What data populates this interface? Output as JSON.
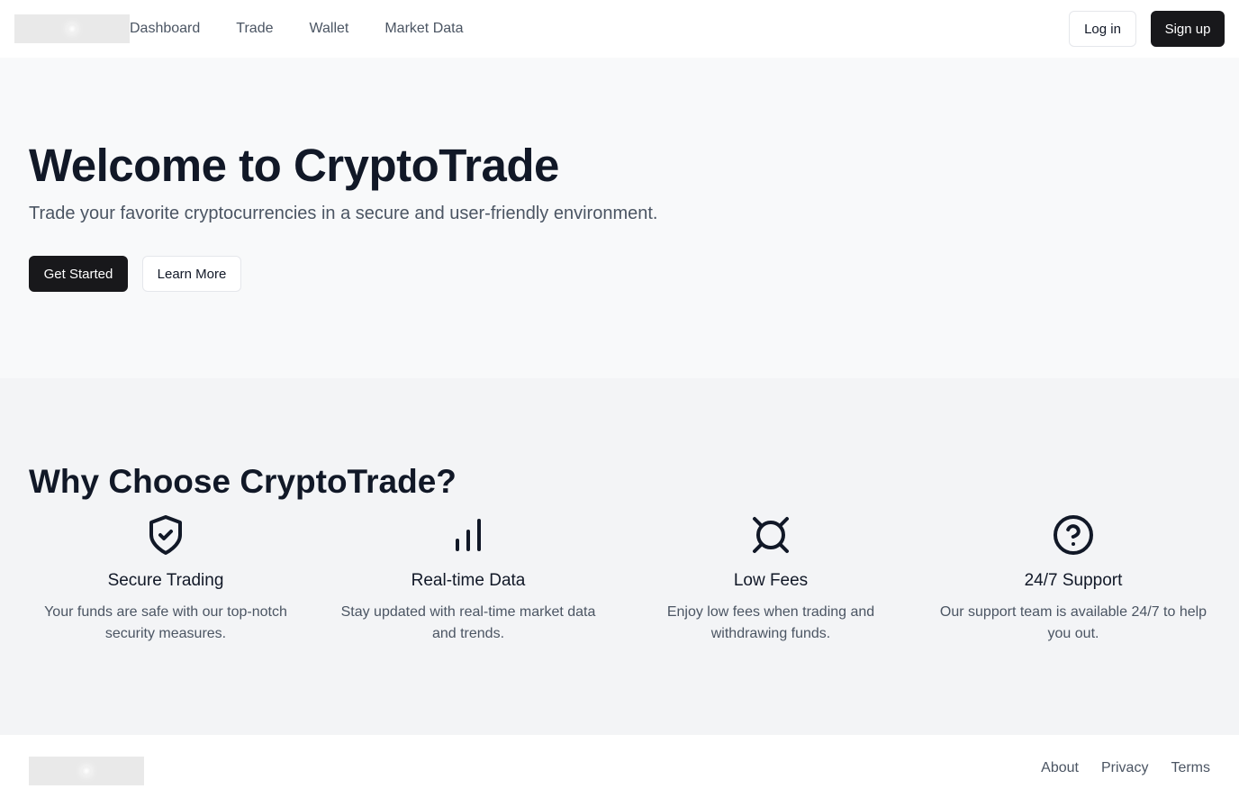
{
  "header": {
    "nav": [
      "Dashboard",
      "Trade",
      "Wallet",
      "Market Data"
    ],
    "login_label": "Log in",
    "signup_label": "Sign up"
  },
  "hero": {
    "title": "Welcome to CryptoTrade",
    "subtitle": "Trade your favorite cryptocurrencies in a secure and user-friendly environment.",
    "primary_label": "Get Started",
    "secondary_label": "Learn More"
  },
  "features": {
    "title": "Why Choose CryptoTrade?",
    "items": [
      {
        "icon": "shield-check-icon",
        "title": "Secure Trading",
        "text": "Your funds are safe with our top-notch security measures."
      },
      {
        "icon": "bar-chart-icon",
        "title": "Real-time Data",
        "text": "Stay updated with real-time market data and trends."
      },
      {
        "icon": "currency-icon",
        "title": "Low Fees",
        "text": "Enjoy low fees when trading and withdrawing funds."
      },
      {
        "icon": "help-circle-icon",
        "title": "24/7 Support",
        "text": "Our support team is available 24/7 to help you out."
      }
    ]
  },
  "footer": {
    "links": [
      "About",
      "Privacy",
      "Terms"
    ]
  },
  "colors": {
    "primary_button": "#18181b",
    "hero_bg": "#f8f9fa",
    "features_bg": "#f3f4f6",
    "text_dark": "#111827",
    "text_muted": "#4b5563"
  }
}
